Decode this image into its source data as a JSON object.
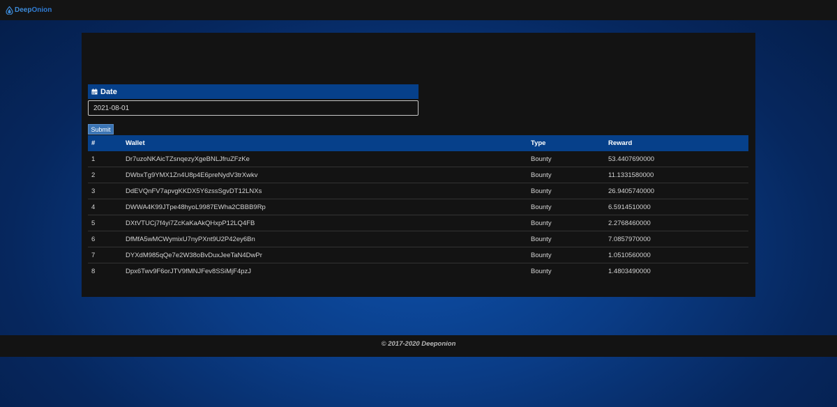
{
  "brand": {
    "name_part1": "Deep",
    "name_part2": "Onion",
    "logo_icon": "onion-drop-icon"
  },
  "form": {
    "date_label": "Date",
    "date_icon": "calendar-icon",
    "date_value": "2021-08-01",
    "submit_label": "Submit"
  },
  "table": {
    "headers": {
      "num": "#",
      "wallet": "Wallet",
      "type": "Type",
      "reward": "Reward"
    },
    "rows": [
      {
        "num": "1",
        "wallet": "Dr7uzoNKAicTZsnqezyXgeBNLJfruZFzKe",
        "type": "Bounty",
        "reward": "53.4407690000"
      },
      {
        "num": "2",
        "wallet": "DWbxTg9YMX1Zn4U8p4E6preNydV3trXwkv",
        "type": "Bounty",
        "reward": "11.1331580000"
      },
      {
        "num": "3",
        "wallet": "DdEVQnFV7apvgKKDX5Y6zssSgvDT12LNXs",
        "type": "Bounty",
        "reward": "26.9405740000"
      },
      {
        "num": "4",
        "wallet": "DWWA4K99JTpe48hyoL9987EWha2CBBB9Rp",
        "type": "Bounty",
        "reward": "6.5914510000"
      },
      {
        "num": "5",
        "wallet": "DXtVTUCj7f4yi7ZcKaKaAkQHxpP12LQ4FB",
        "type": "Bounty",
        "reward": "2.2768460000"
      },
      {
        "num": "6",
        "wallet": "DfMfA5wMCWymixU7nyPXnt9U2P42ey6Bn",
        "type": "Bounty",
        "reward": "7.0857970000"
      },
      {
        "num": "7",
        "wallet": "DYXdM985qQe7e2W38oBvDuxJeeTaN4DwPr",
        "type": "Bounty",
        "reward": "1.0510560000"
      },
      {
        "num": "8",
        "wallet": "Dpx6Twv9F6orJTV9fMNJFev8SSiMjF4pzJ",
        "type": "Bounty",
        "reward": "1.4803490000"
      }
    ]
  },
  "footer": {
    "copyright": "© 2017-2020 Deeponion"
  },
  "colors": {
    "accent": "#06408a",
    "brand": "#3d8bd9",
    "panel": "#131313"
  }
}
